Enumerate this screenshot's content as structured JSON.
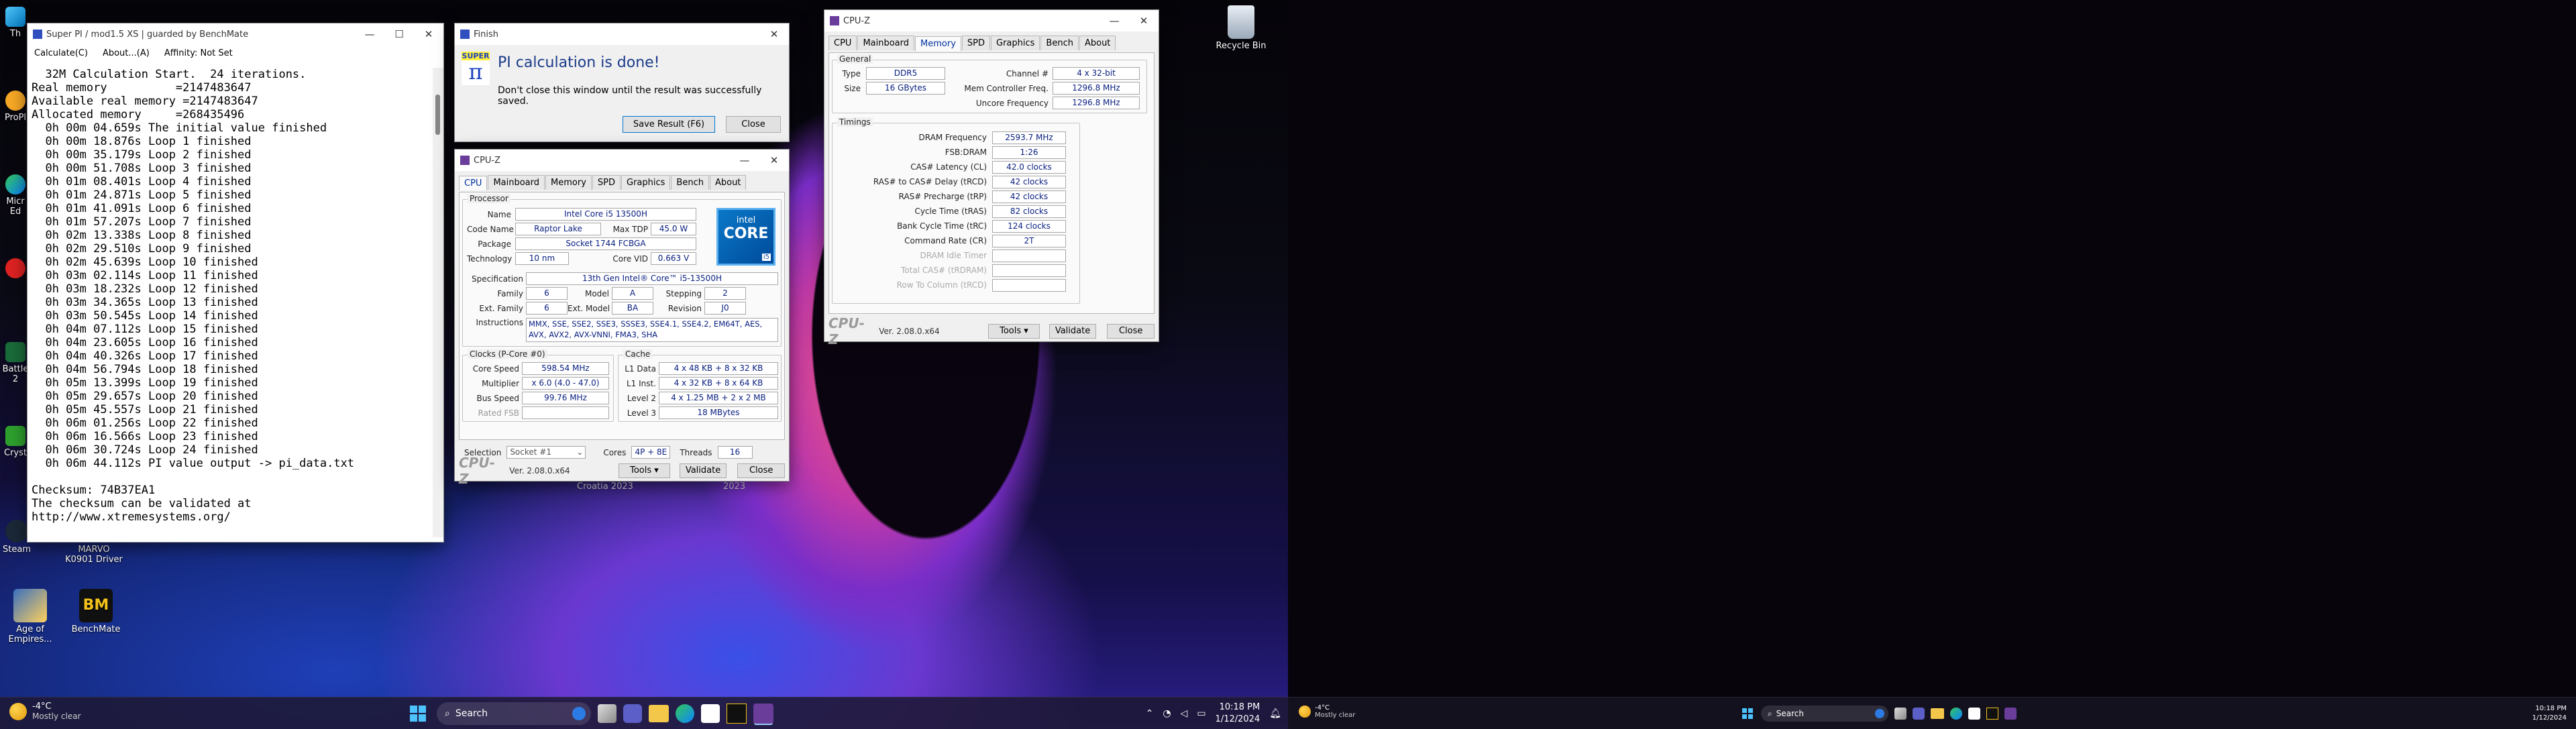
{
  "desktop_left": {
    "icons": [
      {
        "label": "Th",
        "icon": "this-pc-icon"
      },
      {
        "label": "ProPl",
        "icon": "app-icon"
      },
      {
        "label": "Micr Ed",
        "icon": "edge-icon"
      },
      {
        "label": "Battle 2",
        "icon": "game-icon"
      },
      {
        "label": "Cryst",
        "icon": "crystal-icon"
      },
      {
        "label": "Steam",
        "icon": "steam-icon"
      },
      {
        "label": "MARVO K0901 Driver",
        "icon": "driver-icon"
      },
      {
        "label": "Age of Empires...",
        "icon": "age-of-empires-icon"
      },
      {
        "label": "BenchMate",
        "icon": "benchmate-icon"
      },
      {
        "label": "Recycle Bin",
        "icon": "recycle-bin-icon"
      }
    ],
    "bg_text": [
      "Croatia 2023",
      "2023"
    ]
  },
  "superpi": {
    "title": "Super PI / mod1.5 XS | guarded by BenchMate",
    "menu": [
      "Calculate(C)",
      "About...(A)",
      "Affinity: Not Set"
    ],
    "lines": [
      "  32M Calculation Start.  24 iterations.",
      "Real memory          =2147483647",
      "Available real memory =2147483647",
      "Allocated memory     =268435496",
      "  0h 00m 04.659s The initial value finished",
      "  0h 00m 18.876s Loop 1 finished",
      "  0h 00m 35.179s Loop 2 finished",
      "  0h 00m 51.708s Loop 3 finished",
      "  0h 01m 08.401s Loop 4 finished",
      "  0h 01m 24.871s Loop 5 finished",
      "  0h 01m 41.091s Loop 6 finished",
      "  0h 01m 57.207s Loop 7 finished",
      "  0h 02m 13.338s Loop 8 finished",
      "  0h 02m 29.510s Loop 9 finished",
      "  0h 02m 45.639s Loop 10 finished",
      "  0h 03m 02.114s Loop 11 finished",
      "  0h 03m 18.232s Loop 12 finished",
      "  0h 03m 34.365s Loop 13 finished",
      "  0h 03m 50.545s Loop 14 finished",
      "  0h 04m 07.112s Loop 15 finished",
      "  0h 04m 23.605s Loop 16 finished",
      "  0h 04m 40.326s Loop 17 finished",
      "  0h 04m 56.794s Loop 18 finished",
      "  0h 05m 13.399s Loop 19 finished",
      "  0h 05m 29.657s Loop 20 finished",
      "  0h 05m 45.557s Loop 21 finished",
      "  0h 06m 01.256s Loop 22 finished",
      "  0h 06m 16.566s Loop 23 finished",
      "  0h 06m 30.724s Loop 24 finished",
      "  0h 06m 44.112s PI value output -> pi_data.txt",
      "",
      "Checksum: 74B37EA1",
      "The checksum can be validated at",
      "http://www.xtremesystems.org/"
    ]
  },
  "finish": {
    "title": "Finish",
    "heading": "PI calculation is done!",
    "message": "Don't close this window until the result was successfully saved.",
    "logo_text": "SUPER",
    "save_button": "Save Result (F6)",
    "close_button": "Close"
  },
  "cpuz_cpu": {
    "title": "CPU-Z",
    "tabs": [
      "CPU",
      "Mainboard",
      "Memory",
      "SPD",
      "Graphics",
      "Bench",
      "About"
    ],
    "processor_group": "Processor",
    "name_label": "Name",
    "name": "Intel Core i5 13500H",
    "codename_label": "Code Name",
    "codename": "Raptor Lake",
    "maxtdp_label": "Max TDP",
    "maxtdp": "45.0 W",
    "package_label": "Package",
    "package": "Socket 1744 FCBGA",
    "technology_label": "Technology",
    "technology": "10 nm",
    "corevid_label": "Core VID",
    "corevid": "0.663 V",
    "spec_label": "Specification",
    "spec": "13th Gen Intel® Core™ i5-13500H",
    "family_label": "Family",
    "family": "6",
    "model_label": "Model",
    "model": "A",
    "stepping_label": "Stepping",
    "stepping": "2",
    "extfamily_label": "Ext. Family",
    "extfamily": "6",
    "extmodel_label": "Ext. Model",
    "extmodel": "BA",
    "revision_label": "Revision",
    "revision": "J0",
    "instr_label": "Instructions",
    "instr1": "MMX, SSE, SSE2, SSE3, SSSE3, SSE4.1, SSE4.2, EM64T, AES,",
    "instr2": "AVX, AVX2, AVX-VNNI, FMA3, SHA",
    "clocks_group": "Clocks (P-Core #0)",
    "corespeed_label": "Core Speed",
    "corespeed": "598.54 MHz",
    "multiplier_label": "Multiplier",
    "multiplier": "x 6.0 (4.0 - 47.0)",
    "busspeed_label": "Bus Speed",
    "busspeed": "99.76 MHz",
    "ratedfsb_label": "Rated FSB",
    "cache_group": "Cache",
    "l1d_label": "L1 Data",
    "l1d": "4 x 48 KB + 8 x 32 KB",
    "l1i_label": "L1 Inst.",
    "l1i": "4 x 32 KB + 8 x 64 KB",
    "l2_label": "Level 2",
    "l2": "4 x 1.25 MB + 2 x 2 MB",
    "l3_label": "Level 3",
    "l3": "18 MBytes",
    "selection_label": "Selection",
    "selection": "Socket #1",
    "cores_label": "Cores",
    "cores": "4P + 8E",
    "threads_label": "Threads",
    "threads": "16",
    "logo_text": "CPU-Z",
    "version": "Ver. 2.08.0.x64",
    "tools": "Tools",
    "validate": "Validate",
    "close": "Close",
    "intel_badge_brand": "intel",
    "intel_badge_core": "CORE",
    "intel_badge_tier": "i5"
  },
  "cpuz_mem": {
    "title": "CPU-Z",
    "tabs": [
      "CPU",
      "Mainboard",
      "Memory",
      "SPD",
      "Graphics",
      "Bench",
      "About"
    ],
    "general_group": "General",
    "type_label": "Type",
    "type": "DDR5",
    "channel_label": "Channel #",
    "channel": "4 x 32-bit",
    "size_label": "Size",
    "size": "16 GBytes",
    "memctrl_label": "Mem Controller Freq.",
    "memctrl": "1296.8 MHz",
    "uncore_label": "Uncore Frequency",
    "uncore": "1296.8 MHz",
    "timings_group": "Timings",
    "timings": [
      {
        "label": "DRAM Frequency",
        "value": "2593.7 MHz"
      },
      {
        "label": "FSB:DRAM",
        "value": "1:26"
      },
      {
        "label": "CAS# Latency (CL)",
        "value": "42.0 clocks"
      },
      {
        "label": "RAS# to CAS# Delay (tRCD)",
        "value": "42 clocks"
      },
      {
        "label": "RAS# Precharge (tRP)",
        "value": "42 clocks"
      },
      {
        "label": "Cycle Time (tRAS)",
        "value": "82 clocks"
      },
      {
        "label": "Bank Cycle Time (tRC)",
        "value": "124 clocks"
      },
      {
        "label": "Command Rate (CR)",
        "value": "2T"
      },
      {
        "label": "DRAM Idle Timer",
        "value": ""
      },
      {
        "label": "Total CAS# (tRDRAM)",
        "value": ""
      },
      {
        "label": "Row To Column (tRCD)",
        "value": ""
      }
    ],
    "logo_text": "CPU-Z",
    "version": "Ver. 2.08.0.x64",
    "tools": "Tools",
    "validate": "Validate",
    "close": "Close"
  },
  "taskbar1": {
    "weather_temp": "-4°C",
    "weather_desc": "Mostly clear",
    "search": "Search",
    "time": "10:18 PM",
    "date": "1/12/2024"
  },
  "taskbar2": {
    "weather_temp": "-4°C",
    "weather_desc": "Mostly clear",
    "search": "Search",
    "time": "10:18 PM",
    "date": "1/12/2024"
  }
}
